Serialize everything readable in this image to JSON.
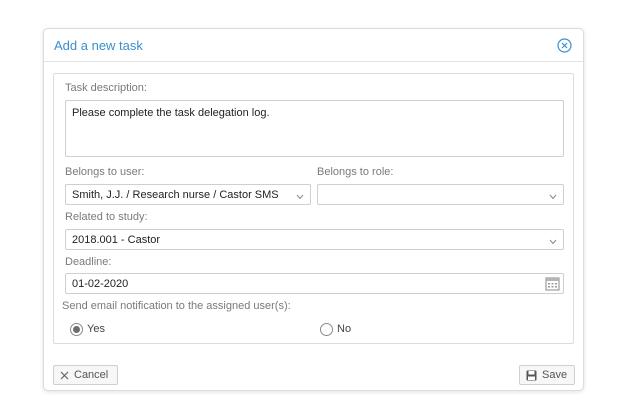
{
  "dialog": {
    "title": "Add a new task"
  },
  "form": {
    "task_description": {
      "label": "Task description:",
      "value": "Please complete the task delegation log."
    },
    "belongs_to_user": {
      "label": "Belongs to user:",
      "value": "Smith, J.J. / Research nurse / Castor SMS"
    },
    "belongs_to_role": {
      "label": "Belongs to role:",
      "value": ""
    },
    "related_to_study": {
      "label": "Related to study:",
      "value": "2018.001 - Castor"
    },
    "deadline": {
      "label": "Deadline:",
      "value": "01-02-2020"
    },
    "email_notification": {
      "label": "Send email notification to the assigned user(s):",
      "options": [
        {
          "label": "Yes",
          "selected": true
        },
        {
          "label": "No",
          "selected": false
        }
      ]
    }
  },
  "footer": {
    "cancel_label": "Cancel",
    "save_label": "Save"
  },
  "icons": {
    "close": "close-circle-icon",
    "chevron": "chevron-down-icon",
    "calendar": "calendar-icon",
    "cancel": "x-icon",
    "save": "floppy-disk-icon"
  },
  "colors": {
    "title": "#3a8fd0",
    "border": "#dcdcdc"
  }
}
